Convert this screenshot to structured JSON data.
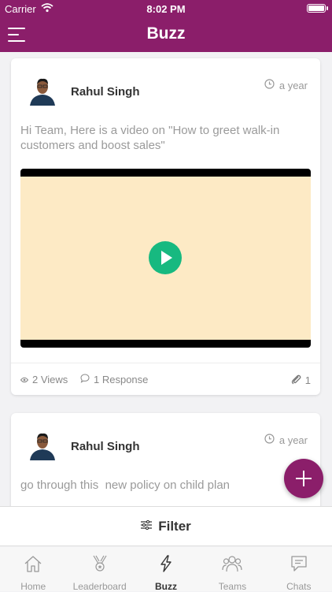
{
  "status_bar": {
    "carrier": "Carrier",
    "time": "8:02 PM"
  },
  "header": {
    "title": "Buzz"
  },
  "posts": [
    {
      "author": "Rahul Singh",
      "time": "a year",
      "message": "Hi Team, Here is a video on \"How to greet walk-in customers and boost sales\"",
      "views": "2 Views",
      "responses": "1 Response",
      "attachments": "1"
    },
    {
      "author": "Rahul Singh",
      "time": "a year",
      "message": "go through this  new policy on child plan"
    }
  ],
  "filter": {
    "label": "Filter"
  },
  "tabs": [
    {
      "label": "Home",
      "icon": "home-icon"
    },
    {
      "label": "Leaderboard",
      "icon": "medal-icon"
    },
    {
      "label": "Buzz",
      "icon": "lightning-icon"
    },
    {
      "label": "Teams",
      "icon": "team-icon"
    },
    {
      "label": "Chats",
      "icon": "chat-icon"
    }
  ],
  "colors": {
    "brand": "#8b1e6a",
    "play": "#17b980",
    "video_bg": "#fdeac5"
  }
}
